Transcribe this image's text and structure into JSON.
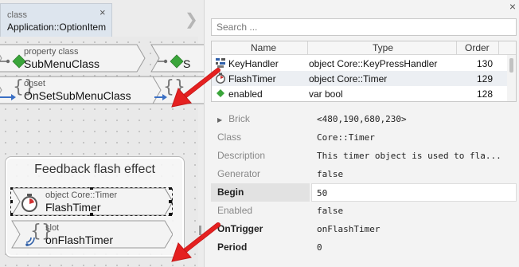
{
  "editor": {
    "tab": {
      "small_label": "class",
      "title": "Application::OptionItem",
      "close_glyph": "×"
    },
    "bricks": [
      {
        "kind": "property class",
        "name": "SubMenuClass",
        "partial_name": "S"
      },
      {
        "kind": "onset",
        "name": "OnSetSubMenuClass"
      }
    ],
    "group": {
      "title": "Feedback flash effect",
      "timer": {
        "kind": "object Core::Timer",
        "name": "FlashTimer"
      },
      "slot": {
        "kind": "slot",
        "name": "onFlashTimer"
      }
    }
  },
  "inspector": {
    "close_glyph": "×",
    "search": {
      "placeholder": "Search ...",
      "value": ""
    },
    "table": {
      "headers": {
        "name": "Name",
        "type": "Type",
        "order": "Order"
      },
      "rows": [
        {
          "icon": "keyhandler-icon",
          "name": "KeyHandler",
          "type": "object Core::KeyPressHandler",
          "order": "130"
        },
        {
          "icon": "timer-icon",
          "name": "FlashTimer",
          "type": "object Core::Timer",
          "order": "129",
          "selected": true
        },
        {
          "icon": "property-icon",
          "name": "enabled",
          "type": "var bool",
          "order": "128"
        }
      ]
    },
    "properties": [
      {
        "label": "Brick",
        "value": "<480,190,680,230>",
        "style": "muted",
        "expander": "▶"
      },
      {
        "label": "Class",
        "value": "Core::Timer",
        "style": "muted"
      },
      {
        "label": "Description",
        "value": "This timer object is used to fla...",
        "style": "muted"
      },
      {
        "label": "Generator",
        "value": "false",
        "style": "muted"
      },
      {
        "label": "Begin",
        "value": "50",
        "style": "bold-highlight"
      },
      {
        "label": "Enabled",
        "value": "false",
        "style": "muted"
      },
      {
        "label": "OnTrigger",
        "value": "onFlashTimer",
        "style": "bold"
      },
      {
        "label": "Period",
        "value": "0",
        "style": "bold"
      }
    ]
  },
  "colors": {
    "annotation_arrow": "#e52020",
    "brick_fill": "#f3f3f3",
    "property_diamond": "#3aa53a",
    "onset_arrow": "#3a6fc4",
    "slot_signal": "#2f5fa8",
    "timer_hand": "#d03030"
  }
}
